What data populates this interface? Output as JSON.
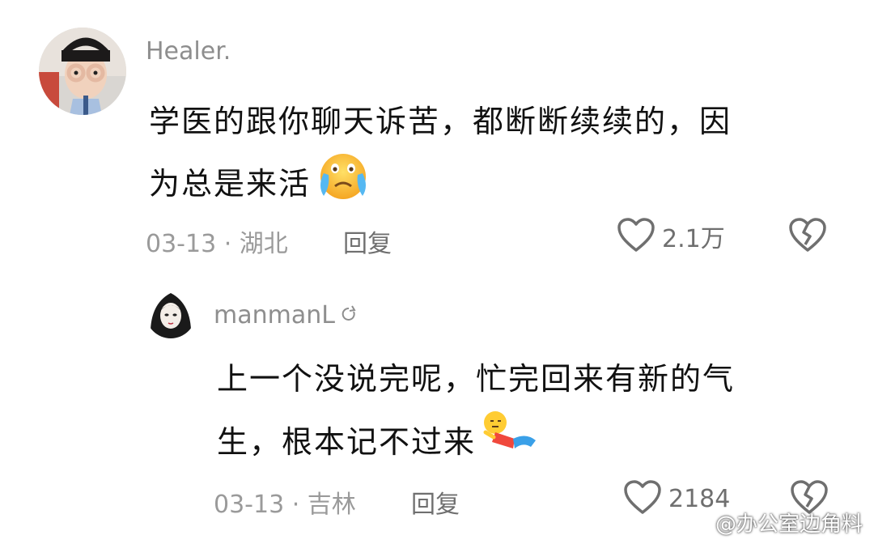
{
  "comments": [
    {
      "username": "Healer.",
      "text_line1": "学医的跟你聊天诉苦，都断断续续的，因",
      "text_line2": "为总是来活",
      "emoji": "crying-face-emoji",
      "date_location": "03-13 · 湖北",
      "reply_label": "回复",
      "likes": "2.1万"
    },
    {
      "username": "manmanL",
      "text_line1": "上一个没说完呢，忙完回来有新的气",
      "text_line2": "生，根本记不过来",
      "emoji": "collapsed-figure-emoji",
      "date_location": "03-13 · 吉林",
      "reply_label": "回复",
      "likes": "2184"
    }
  ],
  "watermark": {
    "text": "@办公室边角料",
    "icon": "weibo-icon"
  },
  "colors": {
    "username": "#8e8e8e",
    "meta": "#9a9a9a",
    "text": "#111111",
    "icon": "#6f6f6f"
  }
}
